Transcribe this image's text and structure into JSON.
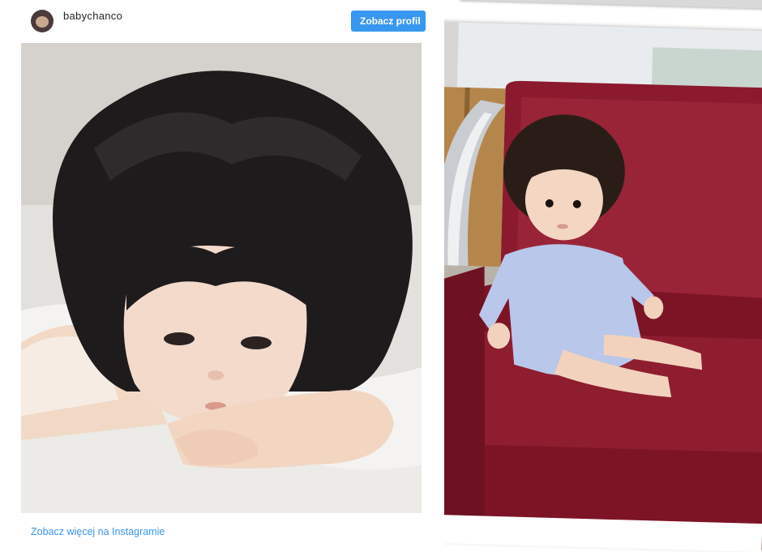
{
  "embed": {
    "username": "babychanco",
    "follow_label": "Zobacz profil",
    "more_link": "Zobacz więcej na Instagramie",
    "photo_icon": "baby-lying-on-arms-photo"
  },
  "right_card": {
    "photo_icon": "baby-sitting-on-red-seat-photo"
  },
  "colors": {
    "button_blue": "#3897f0",
    "link_blue": "#3897f0",
    "seat_red": "#8b1a2e"
  }
}
